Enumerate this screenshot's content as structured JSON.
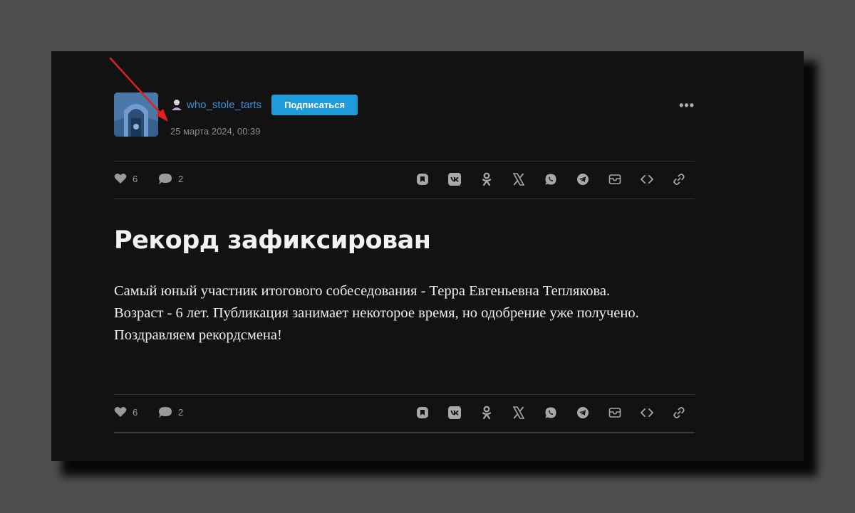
{
  "post": {
    "author": "who_stole_tarts",
    "subscribe_label": "Подписаться",
    "date": "25 марта 2024, 00:39",
    "more_label": "•••",
    "title": "Рекорд зафиксирован",
    "body_lines": [
      "Самый юный участник итогового собеседования - Терра Евгеньевна Теплякова. Возраст - 6 лет. Публикация занимает некоторое время, но одобрение уже получено.",
      "Поздравляем рекордсмена!"
    ],
    "likes": "6",
    "comments": "2"
  },
  "share_icons": [
    "bookmark-icon",
    "vk-icon",
    "odnoklassniki-icon",
    "x-icon",
    "whatsapp-icon",
    "telegram-icon",
    "mail-icon",
    "embed-icon",
    "link-icon"
  ],
  "colors": {
    "page_bg": "#4e4e4e",
    "card_bg": "#121212",
    "accent": "#1f9bd9",
    "link": "#3d8fd6",
    "annotation_arrow": "#e02020"
  }
}
